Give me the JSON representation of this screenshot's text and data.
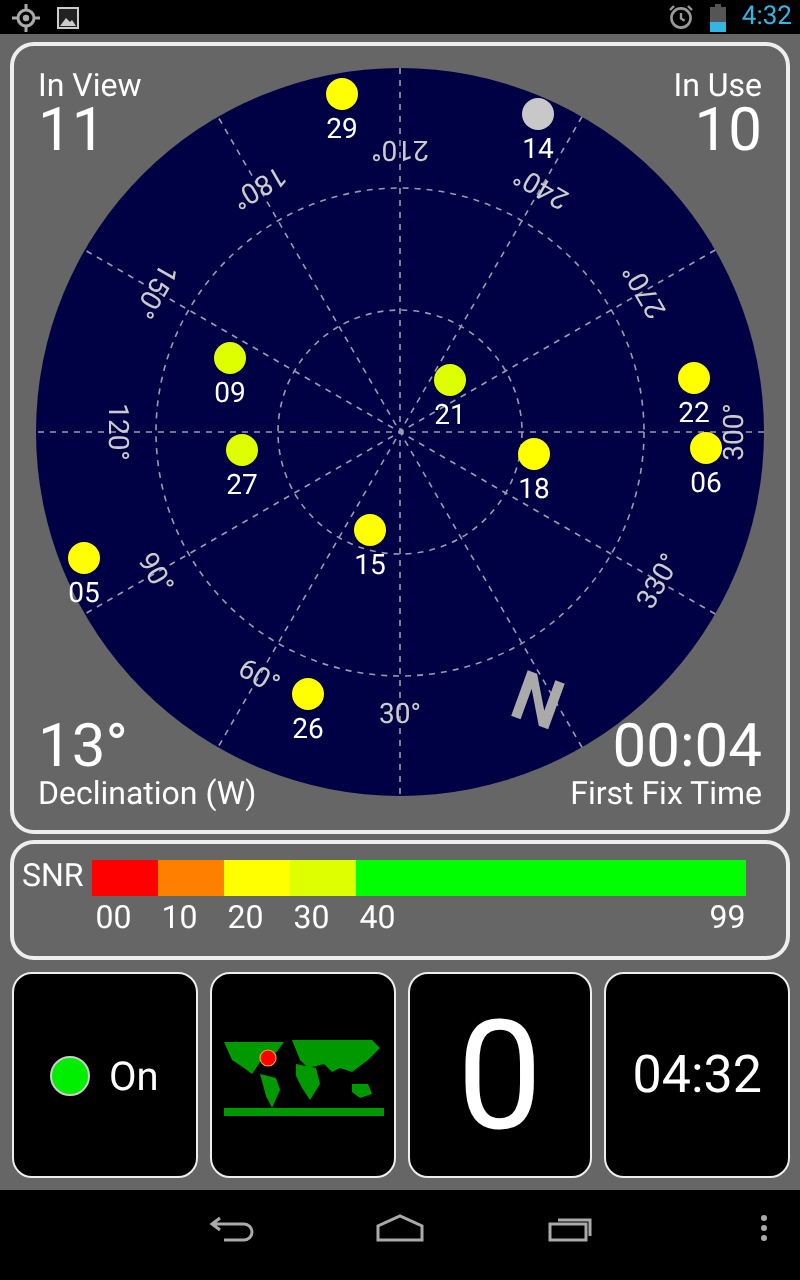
{
  "status_bar": {
    "time": "4:32"
  },
  "sky_view": {
    "in_view_label": "In View",
    "in_view": "11",
    "in_use_label": "In Use",
    "in_use": "10",
    "declination": "13°",
    "declination_label": "Declination (W)",
    "first_fix": "00:04",
    "first_fix_label": "First Fix Time",
    "north": "N",
    "bearings": [
      "30°",
      "60°",
      "90°",
      "120°",
      "150°",
      "180°",
      "210°",
      "240°",
      "270°",
      "300°",
      "330°"
    ],
    "satellites": [
      {
        "id": "29",
        "color": "#ffff00"
      },
      {
        "id": "14",
        "color": "#c8c8c8"
      },
      {
        "id": "09",
        "color": "#ddff00"
      },
      {
        "id": "21",
        "color": "#ddff00"
      },
      {
        "id": "22",
        "color": "#ffff00"
      },
      {
        "id": "27",
        "color": "#ddff00"
      },
      {
        "id": "18",
        "color": "#ffff00"
      },
      {
        "id": "06",
        "color": "#ffff00"
      },
      {
        "id": "15",
        "color": "#ffff00"
      },
      {
        "id": "05",
        "color": "#ffff00"
      },
      {
        "id": "26",
        "color": "#ffff00"
      }
    ]
  },
  "snr": {
    "label": "SNR",
    "segments": [
      {
        "label": "00",
        "color": "#ff0000"
      },
      {
        "label": "10",
        "color": "#ff8000"
      },
      {
        "label": "20",
        "color": "#ffff00"
      },
      {
        "label": "30",
        "color": "#ddff00"
      },
      {
        "label": "40",
        "color": "#00ff00"
      }
    ],
    "max_label": "99"
  },
  "tiles": {
    "gps": {
      "label": "On",
      "on": true
    },
    "fix_count": "0",
    "clock": "04:32"
  }
}
